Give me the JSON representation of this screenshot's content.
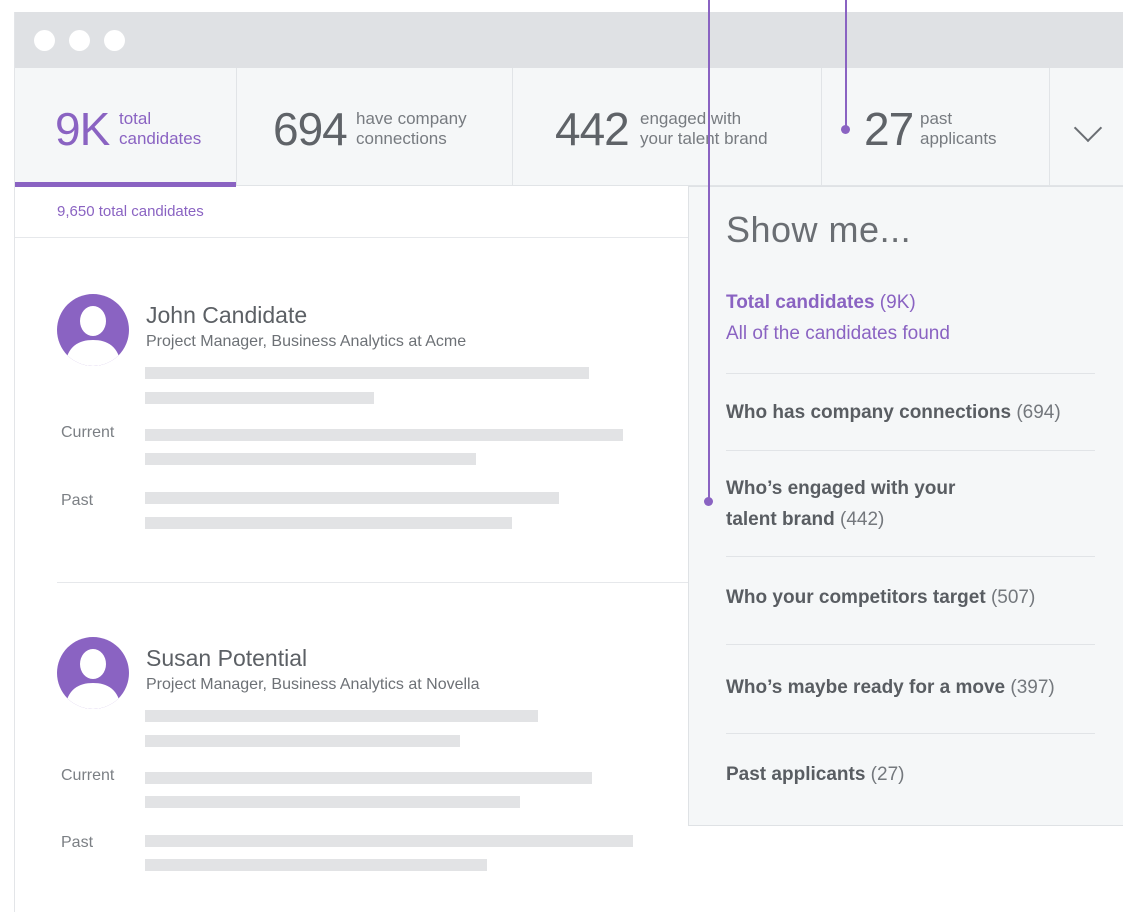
{
  "window": {
    "dots": [
      "close",
      "minimize",
      "maximize"
    ]
  },
  "stats": [
    {
      "number": "9K",
      "label_line1": "total",
      "label_line2": "candidates",
      "active": true
    },
    {
      "number": "694",
      "label_line1": "have company",
      "label_line2": "connections"
    },
    {
      "number": "442",
      "label_line1": "engaged with",
      "label_line2": "your talent brand"
    },
    {
      "number": "27",
      "label_line1": "past",
      "label_line2": "applicants"
    }
  ],
  "expand_icon": "chevron-down-icon",
  "results": {
    "count_text": "9,650 total candidates"
  },
  "candidates": [
    {
      "name": "John Candidate",
      "title": "Project Manager, Business Analytics at Acme",
      "current_label": "Current",
      "past_label": "Past"
    },
    {
      "name": "Susan Potential",
      "title": "Project Manager, Business Analytics at Novella",
      "current_label": "Current",
      "past_label": "Past"
    }
  ],
  "panel": {
    "title": "Show me...",
    "options": [
      {
        "label": "Total candidates",
        "count": "(9K)",
        "subtitle": "All of the candidates found",
        "selected": true
      },
      {
        "label": "Who has company connections",
        "count": "(694)"
      },
      {
        "label_line1": "Who’s engaged with your",
        "label_line2": "talent brand",
        "count": "(442)"
      },
      {
        "label": "Who your competitors target",
        "count": "(507)"
      },
      {
        "label": "Who’s maybe ready for a move",
        "count": "(397)"
      },
      {
        "label": "Past applicants",
        "count": "(27)"
      }
    ]
  },
  "colors": {
    "accent": "#8a63c2",
    "titlebar": "#dfe1e4",
    "panel_bg": "#f5f7f8",
    "placeholder_bar": "#e2e3e5"
  }
}
